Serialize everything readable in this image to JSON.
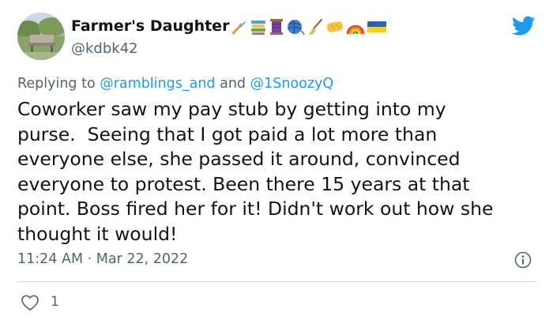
{
  "user": {
    "display_name": "Farmer's Daughter",
    "handle": "@kdbk42",
    "name_emojis": [
      "paintbrush",
      "books",
      "spool-of-thread",
      "yarn-ball",
      "broom",
      "sponge",
      "rainbow",
      "ukraine-flag"
    ]
  },
  "reply": {
    "prefix": "Replying to ",
    "mention_1": "@ramblings_and",
    "joiner": " and ",
    "mention_2": "@1SnoozyQ"
  },
  "tweet": {
    "text": "Coworker saw my pay stub by getting into my\npurse.  Seeing that I got paid a lot more than\neveryone else, she passed it around, convinced\neveryone to protest. Been there 15 years at that\npoint. Boss fired her for it! Didn't work out how she\nthought it would!",
    "timestamp": "11:24 AM · Mar 22, 2022"
  },
  "actions": {
    "like_count": "1"
  },
  "colors": {
    "text": "#0f1419",
    "secondary": "#536471",
    "accent": "#1d9bf0",
    "divider": "#cfd9de",
    "brand": "#1d9bf0"
  }
}
